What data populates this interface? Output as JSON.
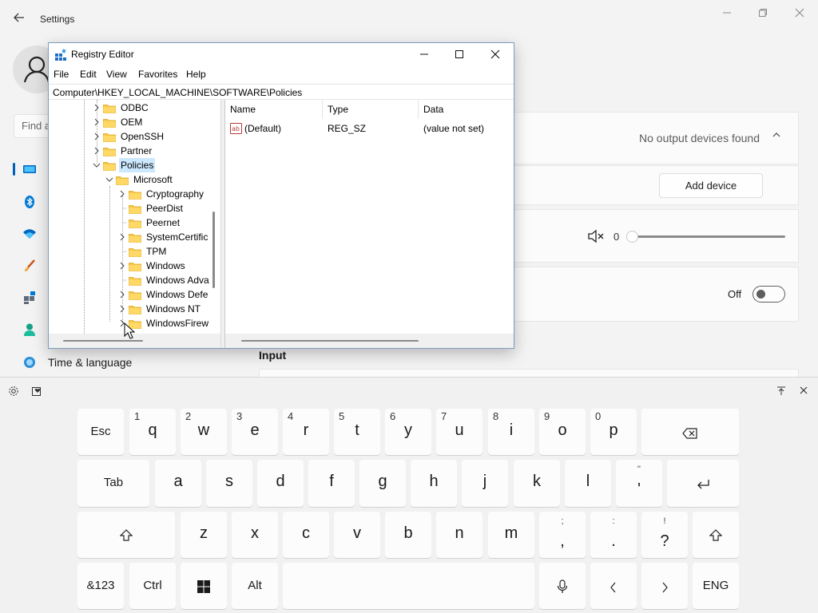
{
  "settings": {
    "title": "Settings",
    "find_placeholder": "Find a",
    "nav_label": "Time & language",
    "output_status": "No output devices found",
    "add_device": "Add device",
    "volume": "0",
    "toggle_state": "Off",
    "input_heading": "Input"
  },
  "regedit": {
    "title": "Registry Editor",
    "menu": [
      "File",
      "Edit",
      "View",
      "Favorites",
      "Help"
    ],
    "address": "Computer\\HKEY_LOCAL_MACHINE\\SOFTWARE\\Policies",
    "tree": [
      {
        "label": "ODBC",
        "expander": "›"
      },
      {
        "label": "OEM",
        "expander": "›"
      },
      {
        "label": "OpenSSH",
        "expander": "›"
      },
      {
        "label": "Partner",
        "expander": "›"
      },
      {
        "label": "Policies",
        "expander": "⌄",
        "selected": true
      },
      {
        "label": "Microsoft",
        "expander": "⌄"
      },
      {
        "label": "Cryptography",
        "expander": "›"
      },
      {
        "label": "PeerDist",
        "expander": ""
      },
      {
        "label": "Peernet",
        "expander": ""
      },
      {
        "label": "SystemCertific",
        "expander": "›"
      },
      {
        "label": "TPM",
        "expander": ""
      },
      {
        "label": "Windows",
        "expander": "›"
      },
      {
        "label": "Windows Adva",
        "expander": ""
      },
      {
        "label": "Windows Defe",
        "expander": "›"
      },
      {
        "label": "Windows NT",
        "expander": "›"
      },
      {
        "label": "WindowsFirew",
        "expander": "›"
      }
    ],
    "columns": [
      "Name",
      "Type",
      "Data"
    ],
    "values": [
      {
        "name": "(Default)",
        "type": "REG_SZ",
        "data": "(value not set)"
      }
    ]
  },
  "keyboard": {
    "row1": [
      {
        "label": "Esc"
      },
      {
        "label": "q",
        "num": "1"
      },
      {
        "label": "w",
        "num": "2"
      },
      {
        "label": "e",
        "num": "3"
      },
      {
        "label": "r",
        "num": "4"
      },
      {
        "label": "t",
        "num": "5"
      },
      {
        "label": "y",
        "num": "6"
      },
      {
        "label": "u",
        "num": "7"
      },
      {
        "label": "i",
        "num": "8"
      },
      {
        "label": "o",
        "num": "9"
      },
      {
        "label": "p",
        "num": "0"
      },
      {
        "label": "⌫"
      }
    ],
    "row2": [
      {
        "label": "Tab"
      },
      {
        "label": "a"
      },
      {
        "label": "s"
      },
      {
        "label": "d"
      },
      {
        "label": "f"
      },
      {
        "label": "g"
      },
      {
        "label": "h"
      },
      {
        "label": "j"
      },
      {
        "label": "k"
      },
      {
        "label": "l"
      },
      {
        "label": "'",
        "top": "\""
      },
      {
        "label": "↵"
      }
    ],
    "row3": [
      {
        "label": "⇧"
      },
      {
        "label": "z"
      },
      {
        "label": "x"
      },
      {
        "label": "c"
      },
      {
        "label": "v"
      },
      {
        "label": "b"
      },
      {
        "label": "n"
      },
      {
        "label": "m"
      },
      {
        "label": ",",
        "top": ";"
      },
      {
        "label": ".",
        "top": ":"
      },
      {
        "label": "?",
        "top": "!"
      },
      {
        "label": "⇧"
      }
    ],
    "row4": [
      {
        "label": "&123"
      },
      {
        "label": "Ctrl"
      },
      {
        "label": "⊞"
      },
      {
        "label": "Alt"
      },
      {
        "label": ""
      },
      {
        "label": "🎤"
      },
      {
        "label": "‹"
      },
      {
        "label": "›"
      },
      {
        "label": "ENG"
      }
    ]
  }
}
